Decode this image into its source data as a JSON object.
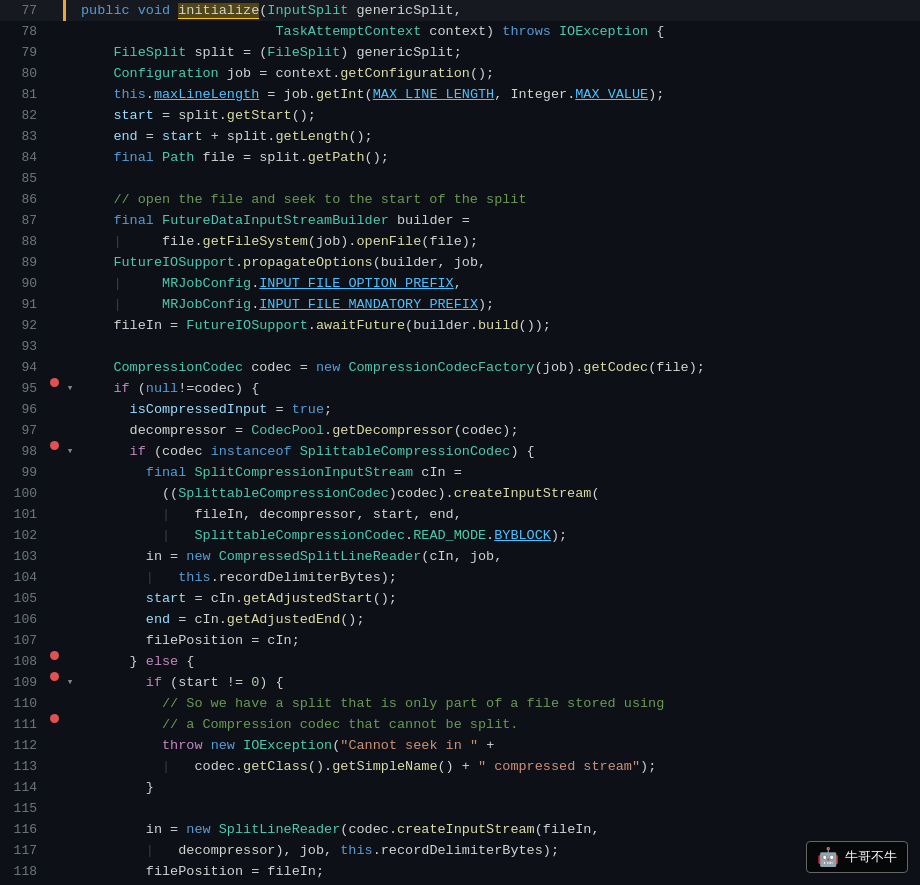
{
  "lines": [
    {
      "num": "77",
      "bp": "none",
      "fold": "none",
      "arrow": true,
      "html": "<span class='kw'>public</span> <span class='kw'>void</span> <span class='highlight-word'>initialize</span>(<span class='type'>InputSplit</span> genericSplit,"
    },
    {
      "num": "78",
      "bp": "none",
      "fold": "none",
      "arrow": false,
      "html": "                        <span class='type'>TaskAttemptContext</span> context) <span class='kw'>throws</span> <span class='type'>IOException</span> {"
    },
    {
      "num": "79",
      "bp": "none",
      "fold": "none",
      "arrow": false,
      "html": "    <span class='type'>FileSplit</span> split = (<span class='type'>FileSplit</span>) genericSplit;"
    },
    {
      "num": "80",
      "bp": "none",
      "fold": "none",
      "arrow": false,
      "html": "    <span class='type'>Configuration</span> job = context.<span class='method'>getConfiguration</span>();"
    },
    {
      "num": "81",
      "bp": "none",
      "fold": "none",
      "arrow": false,
      "html": "    <span class='kw'>this</span>.<span class='const'>maxLineLength</span> = job.<span class='method'>getInt</span>(<span class='const'>MAX_LINE_LENGTH</span>, Integer.<span class='const'>MAX_VALUE</span>);"
    },
    {
      "num": "82",
      "bp": "none",
      "fold": "none",
      "arrow": false,
      "html": "    <span class='param'>start</span> = split.<span class='method'>getStart</span>();"
    },
    {
      "num": "83",
      "bp": "none",
      "fold": "none",
      "arrow": false,
      "html": "    <span class='param'>end</span> = <span class='param'>start</span> + split.<span class='method'>getLength</span>();"
    },
    {
      "num": "84",
      "bp": "none",
      "fold": "none",
      "arrow": false,
      "html": "    <span class='kw'>final</span> <span class='type'>Path</span> file = split.<span class='method'>getPath</span>();"
    },
    {
      "num": "85",
      "bp": "none",
      "fold": "none",
      "arrow": false,
      "html": ""
    },
    {
      "num": "86",
      "bp": "none",
      "fold": "none",
      "arrow": false,
      "html": "    <span class='comment'>// open the file and seek to the start of the split</span>"
    },
    {
      "num": "87",
      "bp": "none",
      "fold": "none",
      "arrow": false,
      "html": "    <span class='kw'>final</span> <span class='type'>FutureDataInputStreamBuilder</span> builder ="
    },
    {
      "num": "88",
      "bp": "none",
      "fold": "none",
      "arrow": false,
      "html": "    <span class='indent-pipe'>|</span>     file.<span class='method'>getFileSystem</span>(job).<span class='method'>openFile</span>(file);"
    },
    {
      "num": "89",
      "bp": "none",
      "fold": "none",
      "arrow": false,
      "html": "    <span class='type'>FutureIOSupport</span>.<span class='method'>propagateOptions</span>(builder, job,"
    },
    {
      "num": "90",
      "bp": "none",
      "fold": "none",
      "arrow": false,
      "html": "    <span class='indent-pipe'>|</span>     <span class='type'>MRJobConfig</span>.<span class='const'>INPUT_FILE_OPTION_PREFIX</span>,"
    },
    {
      "num": "91",
      "bp": "none",
      "fold": "none",
      "arrow": false,
      "html": "    <span class='indent-pipe'>|</span>     <span class='type'>MRJobConfig</span>.<span class='const'>INPUT_FILE_MANDATORY_PREFIX</span>);"
    },
    {
      "num": "92",
      "bp": "none",
      "fold": "none",
      "arrow": false,
      "html": "    fileIn = <span class='type'>FutureIOSupport</span>.<span class='method'>awaitFuture</span>(builder.<span class='method'>build</span>());"
    },
    {
      "num": "93",
      "bp": "none",
      "fold": "none",
      "arrow": false,
      "html": ""
    },
    {
      "num": "94",
      "bp": "none",
      "fold": "none",
      "arrow": false,
      "html": "    <span class='type'>CompressionCodec</span> codec = <span class='kw'>new</span> <span class='type'>CompressionCodecFactory</span>(job).<span class='method'>getCodec</span>(file);"
    },
    {
      "num": "95",
      "bp": "dot",
      "fold": "close",
      "arrow": false,
      "html": "    <span class='kw2'>if</span> (<span class='kw'>null</span>!=codec) {"
    },
    {
      "num": "96",
      "bp": "none",
      "fold": "none",
      "arrow": false,
      "html": "      <span class='param'>isCompressedInput</span> = <span class='kw'>true</span>;"
    },
    {
      "num": "97",
      "bp": "none",
      "fold": "none",
      "arrow": false,
      "html": "      decompressor = <span class='type'>CodecPool</span>.<span class='method'>getDecompressor</span>(codec);"
    },
    {
      "num": "98",
      "bp": "dot",
      "fold": "close",
      "arrow": false,
      "html": "      <span class='kw2'>if</span> (codec <span class='kw'>instanceof</span> <span class='type'>SplittableCompressionCodec</span>) {"
    },
    {
      "num": "99",
      "bp": "none",
      "fold": "none",
      "arrow": false,
      "html": "        <span class='kw'>final</span> <span class='type'>SplitCompressionInputStream</span> cIn ="
    },
    {
      "num": "100",
      "bp": "none",
      "fold": "none",
      "arrow": false,
      "html": "          ((<span class='type'>SplittableCompressionCodec</span>)codec).<span class='method'>createInputStream</span>("
    },
    {
      "num": "101",
      "bp": "none",
      "fold": "none",
      "arrow": false,
      "html": "          <span class='indent-pipe'>|</span>   fileIn, decompressor, start, end,"
    },
    {
      "num": "102",
      "bp": "none",
      "fold": "none",
      "arrow": false,
      "html": "          <span class='indent-pipe'>|</span>   <span class='type'>SplittableCompressionCodec</span>.<span class='type'>READ_MODE</span>.<span class='const'>BYBLOCK</span>);"
    },
    {
      "num": "103",
      "bp": "none",
      "fold": "none",
      "arrow": false,
      "html": "        in = <span class='kw'>new</span> <span class='type'>CompressedSplitLineReader</span>(cIn, job,"
    },
    {
      "num": "104",
      "bp": "none",
      "fold": "none",
      "arrow": false,
      "html": "        <span class='indent-pipe'>|</span>   <span class='kw'>this</span>.recordDelimiterBytes);"
    },
    {
      "num": "105",
      "bp": "none",
      "fold": "none",
      "arrow": false,
      "html": "        <span class='param'>start</span> = cIn.<span class='method'>getAdjustedStart</span>();"
    },
    {
      "num": "106",
      "bp": "none",
      "fold": "none",
      "arrow": false,
      "html": "        <span class='param'>end</span> = cIn.<span class='method'>getAdjustedEnd</span>();"
    },
    {
      "num": "107",
      "bp": "none",
      "fold": "none",
      "arrow": false,
      "html": "        filePosition = cIn;"
    },
    {
      "num": "108",
      "bp": "dot",
      "fold": "none",
      "arrow": false,
      "html": "      } <span class='kw2'>else</span> {"
    },
    {
      "num": "109",
      "bp": "dot",
      "fold": "close",
      "arrow": false,
      "html": "        <span class='kw2'>if</span> (start != <span class='num'>0</span>) {"
    },
    {
      "num": "110",
      "bp": "none",
      "fold": "none",
      "arrow": false,
      "html": "          <span class='comment'>// So we have a split that is only part of a file stored using</span>"
    },
    {
      "num": "111",
      "bp": "dot",
      "fold": "none",
      "arrow": false,
      "html": "          <span class='comment'>// a Compression codec that cannot be split.</span>"
    },
    {
      "num": "112",
      "bp": "none",
      "fold": "none",
      "arrow": false,
      "html": "          <span class='kw2'>throw</span> <span class='kw'>new</span> <span class='type'>IOException</span>(<span class='str'>\"Cannot seek in \"</span> +"
    },
    {
      "num": "113",
      "bp": "none",
      "fold": "none",
      "arrow": false,
      "html": "          <span class='indent-pipe'>|</span>   codec.<span class='method'>getClass</span>().<span class='method'>getSimpleName</span>() + <span class='str'>\" compressed stream\"</span>);"
    },
    {
      "num": "114",
      "bp": "none",
      "fold": "none",
      "arrow": false,
      "html": "        }"
    },
    {
      "num": "115",
      "bp": "none",
      "fold": "none",
      "arrow": false,
      "html": ""
    },
    {
      "num": "116",
      "bp": "none",
      "fold": "none",
      "arrow": false,
      "html": "        in = <span class='kw'>new</span> <span class='type'>SplitLineReader</span>(codec.<span class='method'>createInputStream</span>(fileIn,"
    },
    {
      "num": "117",
      "bp": "none",
      "fold": "none",
      "arrow": false,
      "html": "        <span class='indent-pipe'>|</span>   decompressor), job, <span class='kw'>this</span>.recordDelimiterBytes);"
    },
    {
      "num": "118",
      "bp": "none",
      "fold": "none",
      "arrow": false,
      "html": "        filePosition = fileIn;"
    }
  ],
  "watermark": {
    "icon": "🤖",
    "text": "牛哥不牛"
  }
}
